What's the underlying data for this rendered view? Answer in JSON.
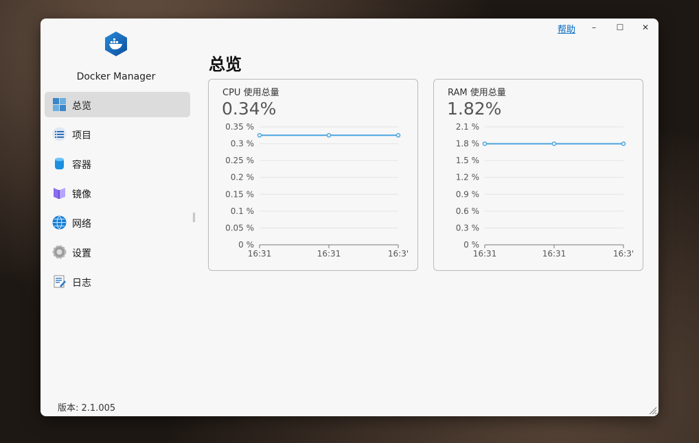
{
  "app": {
    "name": "Docker Manager",
    "version_text": "版本: 2.1.005"
  },
  "titlebar": {
    "help": "帮助",
    "minimize_glyph": "–",
    "maximize_glyph": "☐",
    "close_glyph": "✕"
  },
  "sidebar": {
    "items": [
      {
        "label": "总览",
        "icon": "overview-icon",
        "active": true
      },
      {
        "label": "项目",
        "icon": "projects-icon",
        "active": false
      },
      {
        "label": "容器",
        "icon": "containers-icon",
        "active": false
      },
      {
        "label": "镜像",
        "icon": "images-icon",
        "active": false
      },
      {
        "label": "网络",
        "icon": "network-icon",
        "active": false
      },
      {
        "label": "设置",
        "icon": "settings-icon",
        "active": false
      },
      {
        "label": "日志",
        "icon": "logs-icon",
        "active": false
      }
    ]
  },
  "main": {
    "title": "总览"
  },
  "colors": {
    "accent": "#0067c0",
    "line": "#4aa3df",
    "grid": "#e3e3e3"
  },
  "chart_data": [
    {
      "type": "line",
      "title": "CPU 使用总量",
      "current_value": "0.34%",
      "x": [
        "16:31",
        "16:31",
        "16:3'"
      ],
      "y_ticks": [
        "0.35 %",
        "0.3 %",
        "0.25 %",
        "0.2 %",
        "0.15 %",
        "0.1 %",
        "0.05 %",
        "0 %"
      ],
      "ylim": [
        0,
        0.35
      ],
      "series": [
        {
          "values": [
            0.325,
            0.325,
            0.325
          ]
        }
      ],
      "grid": true
    },
    {
      "type": "line",
      "title": "RAM 使用总量",
      "current_value": "1.82%",
      "x": [
        "16:31",
        "16:31",
        "16:3'"
      ],
      "y_ticks": [
        "2.1 %",
        "1.8 %",
        "1.5 %",
        "1.2 %",
        "0.9 %",
        "0.6 %",
        "0.3 %",
        "0 %"
      ],
      "ylim": [
        0,
        2.1
      ],
      "series": [
        {
          "values": [
            1.8,
            1.8,
            1.8
          ]
        }
      ],
      "grid": true
    }
  ]
}
